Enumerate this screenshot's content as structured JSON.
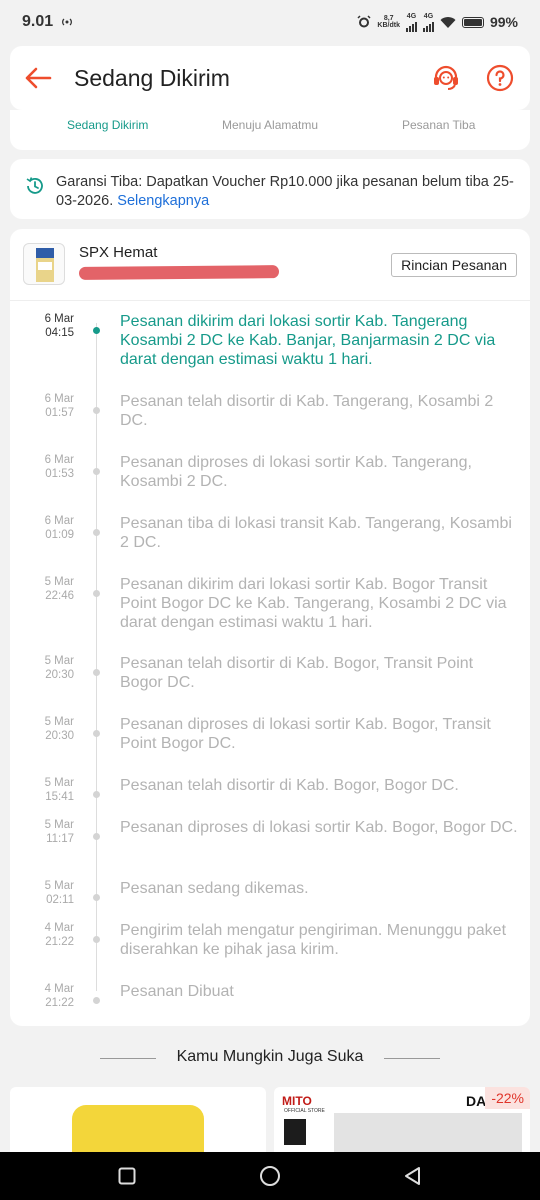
{
  "status_bar": {
    "time": "9.01",
    "net_speed_value": "8,7",
    "net_speed_unit": "KB/dtk",
    "network_1": "4G",
    "network_2": "4G",
    "battery": "99%"
  },
  "header": {
    "title": "Sedang Dikirim",
    "back_icon": "arrow-left-icon",
    "support_icon": "headset-icon",
    "help_icon": "question-circle-icon"
  },
  "steps": [
    "Sedang Dikirim",
    "Menuju Alamatmu",
    "Pesanan Tiba"
  ],
  "notice": {
    "text": "Garansi Tiba: Dapatkan Voucher Rp10.000 jika pesanan belum tiba 25-03-2026.",
    "link": "Selengkapnya"
  },
  "shipment": {
    "carrier": "SPX Hemat",
    "detail_button": "Rincian Pesanan",
    "events": [
      {
        "date": "6 Mar",
        "time": "04:15",
        "text": "Pesanan dikirim dari lokasi sortir Kab. Tangerang Kosambi 2 DC ke Kab. Banjar, Banjarmasin 2 DC via darat dengan estimasi waktu 1 hari."
      },
      {
        "date": "6 Mar",
        "time": "01:57",
        "text": "Pesanan telah disortir di Kab. Tangerang, Kosambi 2 DC."
      },
      {
        "date": "6 Mar",
        "time": "01:53",
        "text": "Pesanan diproses di lokasi sortir Kab. Tangerang, Kosambi 2 DC."
      },
      {
        "date": "6 Mar",
        "time": "01:09",
        "text": "Pesanan tiba di lokasi transit Kab. Tangerang, Kosambi 2 DC."
      },
      {
        "date": "5 Mar",
        "time": "22:46",
        "text": "Pesanan dikirim dari lokasi sortir Kab. Bogor  Transit Point Bogor DC ke Kab. Tangerang, Kosambi 2 DC via darat dengan estimasi waktu 1 hari."
      },
      {
        "date": "5 Mar",
        "time": "20:30",
        "text": "Pesanan telah disortir di Kab. Bogor, Transit Point Bogor DC."
      },
      {
        "date": "5 Mar",
        "time": "20:30",
        "text": "Pesanan diproses di lokasi sortir Kab. Bogor, Transit Point Bogor DC."
      },
      {
        "date": "5 Mar",
        "time": "15:41",
        "text": "Pesanan telah disortir di Kab. Bogor, Bogor DC."
      },
      {
        "date": "5 Mar",
        "time": "11:17",
        "text": "Pesanan diproses di lokasi sortir Kab. Bogor, Bogor DC."
      },
      {
        "date": "5 Mar",
        "time": "02:11",
        "text": "Pesanan sedang dikemas."
      },
      {
        "date": "4 Mar",
        "time": "21:22",
        "text": "Pengirim telah mengatur pengiriman. Menunggu paket diserahkan ke pihak jasa kirim."
      },
      {
        "date": "4 Mar",
        "time": "21:22",
        "text": "Pesanan Dibuat"
      }
    ]
  },
  "recommendations": {
    "title": "Kamu Mungkin Juga Suka",
    "products": [
      {
        "brand": "",
        "discount": ""
      },
      {
        "brand": "MITO",
        "brand_sub": "OFFICIAL STORE",
        "brand_right": "DAI",
        "discount": "-22%"
      }
    ]
  },
  "nav": {
    "recent": "square-icon",
    "home": "circle-icon",
    "back": "triangle-back-icon"
  },
  "colors": {
    "accent": "#ee4d2d",
    "teal": "#169a8a",
    "link": "#1e6fd9"
  }
}
